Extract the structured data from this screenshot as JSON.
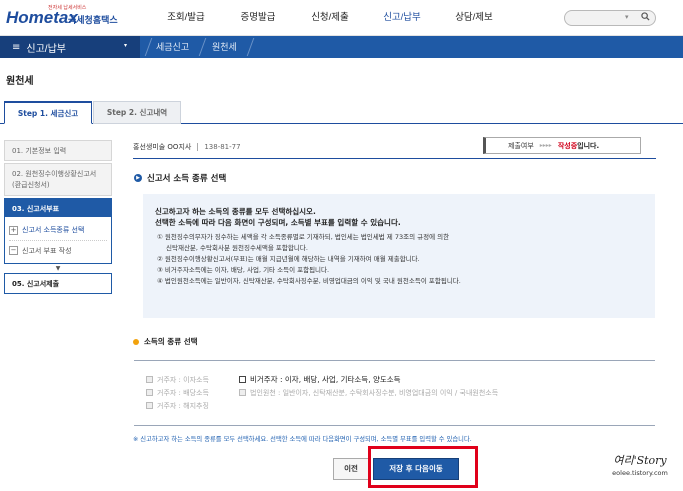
{
  "header": {
    "logo_tagline": "전자세 납세서비스",
    "logo_word": "Hometax",
    "logo_kr": "국세청홈택스",
    "nav": [
      "조회/발급",
      "증명발급",
      "신청/제출",
      "신고/납부",
      "상담/제보"
    ],
    "search_placeholder": "",
    "search_arrow": "▾",
    "search_icon": "🔍"
  },
  "breadcrumb": {
    "menu_icon": "≡",
    "menu_label": "신고/납부",
    "dropdown": "▾",
    "items": [
      "세금신고",
      "원천세"
    ]
  },
  "page_title": "원천세",
  "steps": {
    "step1": "Step 1. 세금신고",
    "step2": "Step 2. 신고내역"
  },
  "left_menu": {
    "item1": "01. 기본정보 입력",
    "item2": "02. 원천징수이행상황신고서(환급신청서)",
    "item3": "03. 신고서부표",
    "sub1": "신고서 소득종류 선택",
    "sub2": "신고서 부표 작성",
    "plus": "+",
    "minus": "−",
    "down": "▼",
    "item5": "05. 신고서제출"
  },
  "company": {
    "name": "홍선생미술 OO지사",
    "bizno": "138-81-77"
  },
  "status": {
    "label": "제출여부",
    "arrows": "▸▸▸▸",
    "value": "작성중",
    "tail": "입니다."
  },
  "section1": {
    "icon": "●",
    "title": "신고서 소득 종류 선택"
  },
  "info": {
    "lead1": "신고하고자 하는 소득의 종류를 모두 선택하십시오.",
    "lead2": "선택한 소득에 따라 다음 화면이 구성되며, 소득별 부표를 입력할 수 있습니다.",
    "note1": "① 원천징수의무자가 징수하는 세액을 각 소득종류별로 기재하되, 법인세는 법인세법 제 73조의 규정에 의한",
    "note1b": "신탁재산분, 수탁회사분 원천징수세액을 포함합니다.",
    "note2": "② 원천징수이행상황신고서(부표)는 매월 지급년월에 해당하는 내역을 기재하여 매월 제출합니다.",
    "note3": "③ 비거주자소득에는 이자, 배당, 사업, 기타 소득이 포함됩니다.",
    "note4": "④ 법인원천소득에는 일반이자, 신탁재산분, 수탁회사징수분, 비영업대금의 이익 및 국내 원천소득이 포함됩니다."
  },
  "section2": {
    "title": "소득의 종류 선택"
  },
  "income_types": {
    "col1": [
      "거주자 : 이자소득",
      "거주자 : 배당소득",
      "거주자 : 해지추징"
    ],
    "nonresident": "비거주자 : 이자, 배당, 사업, 기타소득, 양도소득",
    "corporate": "법인원천 : 일반이자, 신탁재산분, 수탁회사징수분, 비영업대금의 이익 / 국내원천소득"
  },
  "footnote": "※ 신고하고자 하는 소득의 종류를 모두 선택하세요. 선택한 소득에 따라 다음화면이 구성되며, 소득별 부표를 입력할 수 있습니다.",
  "buttons": {
    "prev": "이전",
    "next": "저장 후 다음이동"
  },
  "watermark": {
    "signature": "여리'Story",
    "url": "eolee.tistory.com"
  },
  "colors": {
    "brand": "#1f5aa6",
    "highlight": "#e0001a",
    "status_red": "#d0021b"
  }
}
